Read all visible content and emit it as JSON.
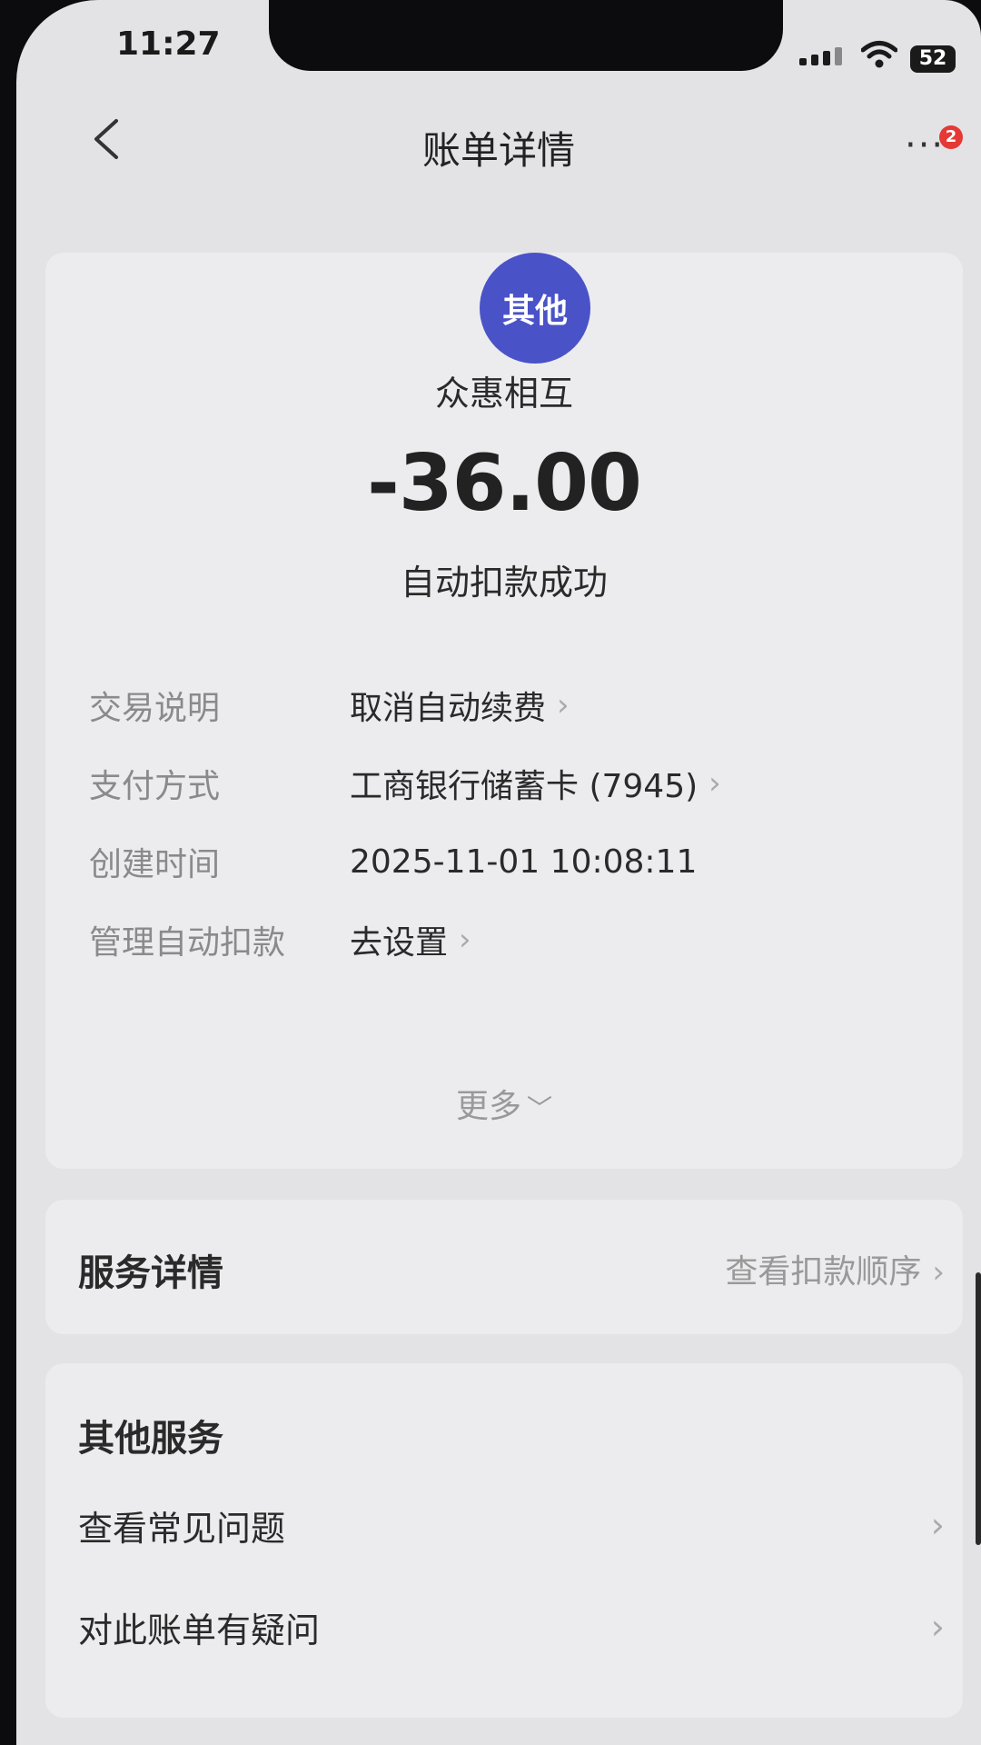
{
  "status_bar": {
    "time": "11:27",
    "battery": "52"
  },
  "header": {
    "title": "账单详情",
    "back_icon": "chevron-left-icon",
    "more_icon": "more-dots-icon",
    "badge_count": "2"
  },
  "bill": {
    "category_badge": "其他",
    "merchant": "众惠相互",
    "amount": "-36.00",
    "status": "自动扣款成功",
    "details": [
      {
        "label": "交易说明",
        "value": "取消自动续费",
        "link": true
      },
      {
        "label": "支付方式",
        "value": "工商银行储蓄卡 (7945)",
        "link": true
      },
      {
        "label": "创建时间",
        "value": "2025-11-01 10:08:11",
        "link": false
      },
      {
        "label": "管理自动扣款",
        "value": "去设置",
        "link": true
      }
    ],
    "more_label": "更多"
  },
  "service": {
    "title": "服务详情",
    "link": "查看扣款顺序"
  },
  "other_services": {
    "title": "其他服务",
    "items": [
      {
        "label": "查看常见问题"
      },
      {
        "label": "对此账单有疑问"
      }
    ]
  },
  "colors": {
    "avatar_bg": "#4a52c8",
    "badge_bg": "#e53935"
  }
}
